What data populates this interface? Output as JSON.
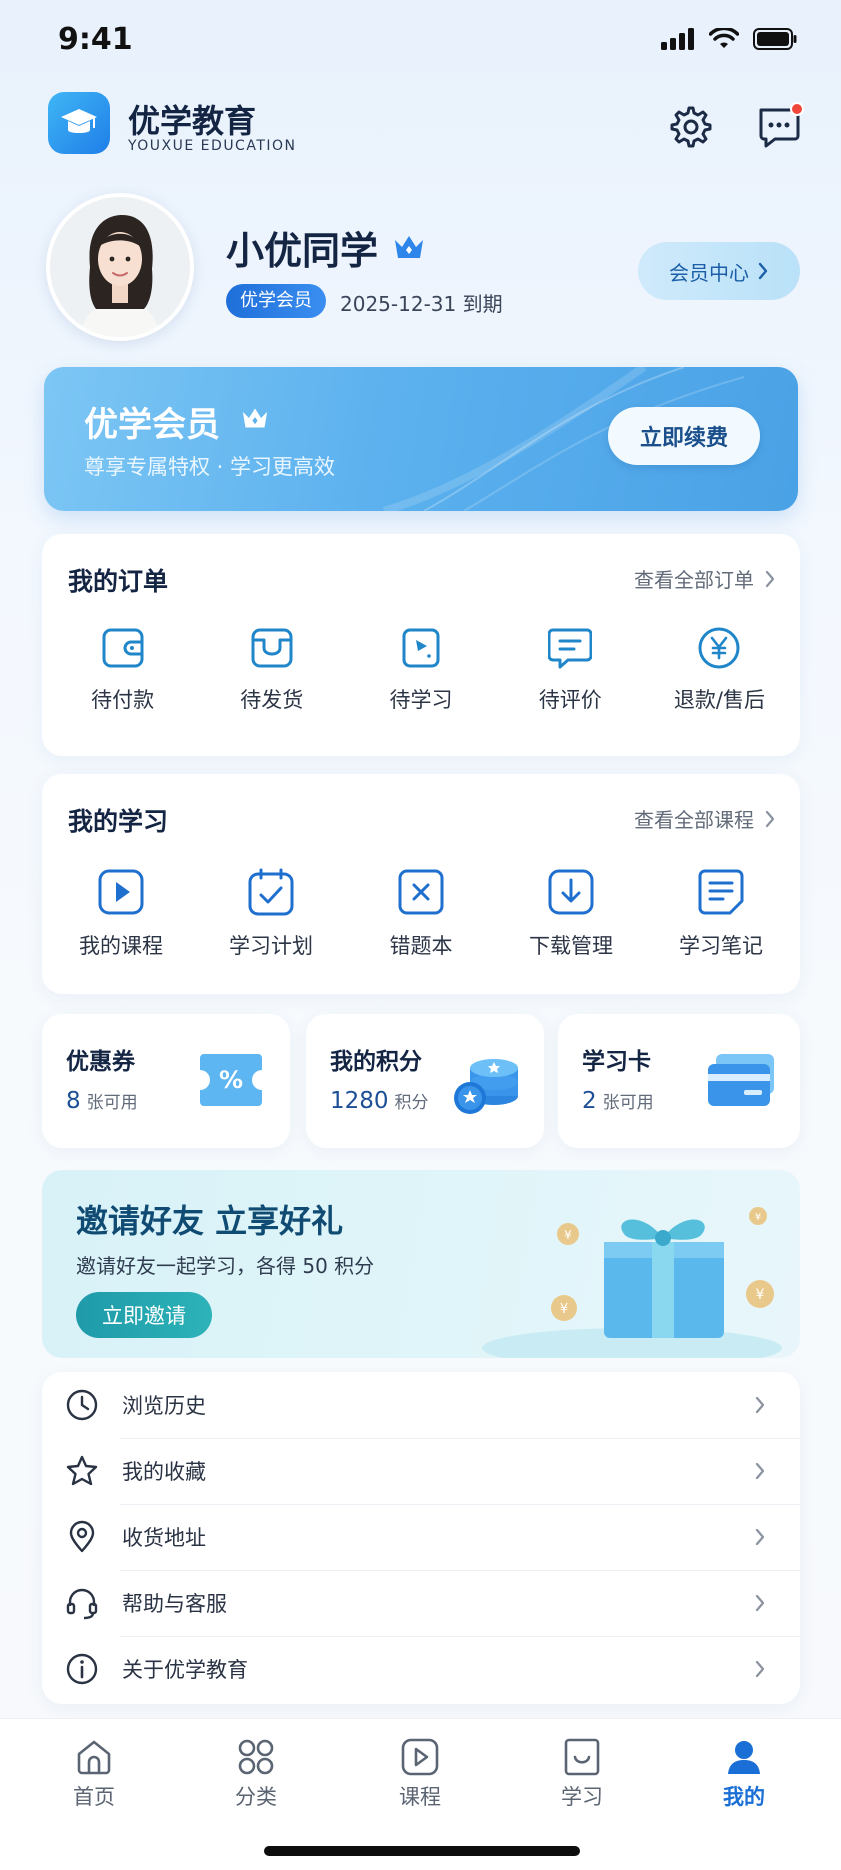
{
  "status": {
    "time": "9:41"
  },
  "brand": {
    "name": "优学教育",
    "sub": "YOUXUE EDUCATION"
  },
  "profile": {
    "name": "小优同学",
    "vip_tag": "优学会员",
    "expire": "2025-12-31 到期",
    "member_center": "会员中心"
  },
  "vip_banner": {
    "title": "优学会员",
    "desc": "尊享专属特权 · 学习更高效",
    "button": "立即续费"
  },
  "orders": {
    "title": "我的订单",
    "more": "查看全部订单",
    "items": [
      {
        "label": "待付款",
        "icon": "wallet-icon"
      },
      {
        "label": "待发货",
        "icon": "package-icon"
      },
      {
        "label": "待学习",
        "icon": "book-icon"
      },
      {
        "label": "待评价",
        "icon": "comment-icon"
      },
      {
        "label": "退款/售后",
        "icon": "refund-icon"
      }
    ]
  },
  "study": {
    "title": "我的学习",
    "more": "查看全部课程",
    "items": [
      {
        "label": "我的课程",
        "icon": "play-icon"
      },
      {
        "label": "学习计划",
        "icon": "calendar-check-icon"
      },
      {
        "label": "错题本",
        "icon": "wrong-book-icon"
      },
      {
        "label": "下载管理",
        "icon": "download-icon"
      },
      {
        "label": "学习笔记",
        "icon": "notes-icon"
      }
    ]
  },
  "assets": [
    {
      "title": "优惠券",
      "value": "8",
      "unit": "张可用",
      "icon": "coupon-icon"
    },
    {
      "title": "我的积分",
      "value": "1280",
      "unit": "积分",
      "icon": "coins-icon"
    },
    {
      "title": "学习卡",
      "value": "2",
      "unit": "张可用",
      "icon": "card-icon"
    }
  ],
  "invite": {
    "title": "邀请好友 立享好礼",
    "desc": "邀请好友一起学习，各得 50 积分",
    "button": "立即邀请"
  },
  "menu": [
    {
      "label": "浏览历史",
      "icon": "clock-icon"
    },
    {
      "label": "我的收藏",
      "icon": "star-icon"
    },
    {
      "label": "收货地址",
      "icon": "location-icon"
    },
    {
      "label": "帮助与客服",
      "icon": "headset-icon"
    },
    {
      "label": "关于优学教育",
      "icon": "info-icon"
    }
  ],
  "tabs": [
    {
      "label": "首页",
      "icon": "home-icon"
    },
    {
      "label": "分类",
      "icon": "category-icon"
    },
    {
      "label": "课程",
      "icon": "course-icon"
    },
    {
      "label": "学习",
      "icon": "study-icon"
    },
    {
      "label": "我的",
      "icon": "profile-icon",
      "active": true
    }
  ],
  "colors": {
    "accent": "#1e6fd9",
    "active_tab": "#1a6fd6",
    "badge_red": "#f0453a"
  }
}
